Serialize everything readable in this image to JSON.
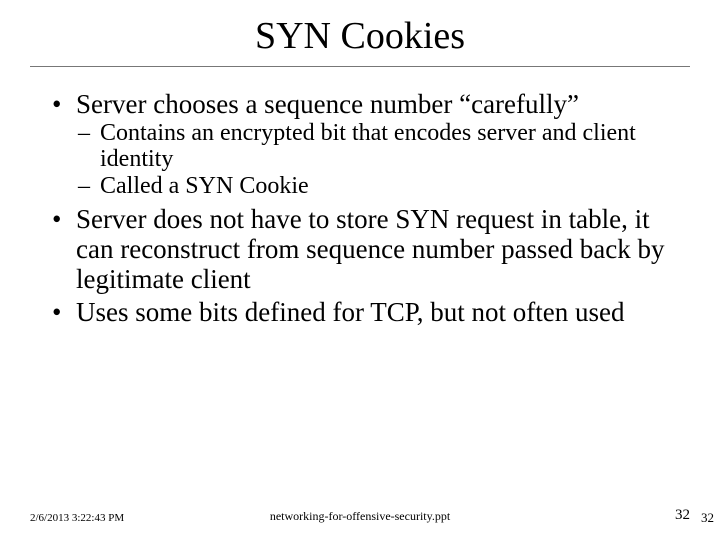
{
  "title": "SYN Cookies",
  "bullets": [
    {
      "text": "Server chooses a sequence number “carefully”",
      "children": [
        {
          "text": "Contains an encrypted bit that encodes server and client identity"
        },
        {
          "text": "Called a SYN Cookie"
        }
      ]
    },
    {
      "text": "Server does not have to store SYN request in table, it can reconstruct from sequence number passed back by legitimate client",
      "children": []
    },
    {
      "text": "Uses some bits defined for TCP, but not often used",
      "children": []
    }
  ],
  "footer": {
    "timestamp": "2/6/2013 3:22:43 PM",
    "filename": "networking-for-offensive-security.ppt",
    "page_inner": "32",
    "page_outer": "32"
  }
}
